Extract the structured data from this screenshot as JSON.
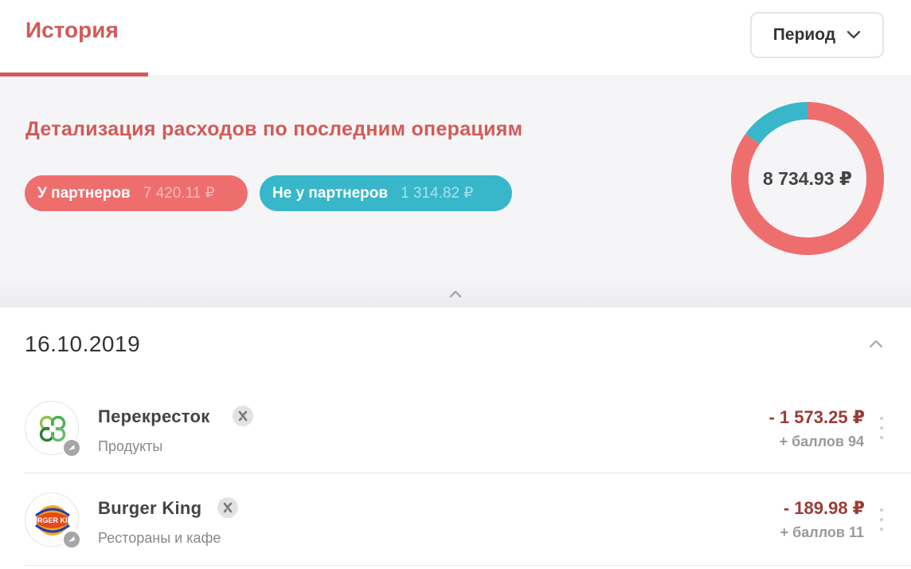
{
  "header": {
    "tab_label": "История",
    "period_label": "Период",
    "period_icon": "chevron-down-icon"
  },
  "summary": {
    "title": "Детализация расходов по последним операциям",
    "partners": {
      "label": "У партнеров",
      "amount": "7 420.11 ₽"
    },
    "non_partners": {
      "label": "Не у партнеров",
      "amount": "1 314.82 ₽"
    },
    "total": "8 734.93 ₽",
    "colors": {
      "partners": "#ee6e6e",
      "non_partners": "#37b7c9",
      "accent": "#d35a56"
    }
  },
  "chart_data": {
    "type": "pie",
    "categories": [
      "У партнеров",
      "Не у партнеров"
    ],
    "values": [
      7420.11,
      1314.82
    ],
    "colors": [
      "#ee6e6e",
      "#37b7c9"
    ],
    "donut": true
  },
  "collapse": {
    "icon": "chevron-up-icon"
  },
  "history": {
    "date": "16.10.2019",
    "date_toggle_icon": "chevron-up-icon",
    "transactions": [
      {
        "merchant": "Перекресток",
        "category": "Продукты",
        "amount": "- 1 573.25 ₽",
        "bonus": "+ баллов 94",
        "logo_icon": "perekrestok-logo-icon",
        "badge_icon": "cashback-icon"
      },
      {
        "merchant": "Burger King",
        "category": "Рестораны и кафе",
        "amount": "- 189.98 ₽",
        "bonus": "+ баллов 11",
        "logo_icon": "burger-king-logo-icon",
        "logo_text": "BURGER KING",
        "badge_icon": "cashback-icon"
      }
    ]
  }
}
